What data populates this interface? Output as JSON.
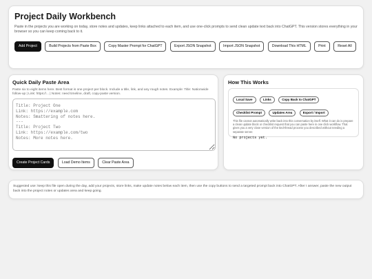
{
  "header": {
    "title": "Project Daily Workbench",
    "intro": "Paste in the projects you are working on today, store notes and updates, keep links attached to each item, and use one-click prompts to send clean update text back into ChatGPT. This version stores everything in your browser so you can keep coming back to it."
  },
  "toolbar": {
    "add_project": "Add Project",
    "build_from_paste": "Build Projects from Paste Box",
    "copy_master_prompt": "Copy Master Prompt for ChatGPT",
    "export_json": "Export JSON Snapshot",
    "import_json": "Import JSON Snapshot",
    "download_html": "Download This HTML",
    "print": "Print",
    "reset_all": "Reset All"
  },
  "paste_area": {
    "title": "Quick Daily Paste Area",
    "help": "Paste six to eight items here. Best format is one project per block. Include a title, link, and any rough notes. Example: Title: Nationwide follow-up | Link: https://... | Notes: need timeline, draft, copy-paste version.",
    "placeholder": "Title: Project One\nLink: https://example.com\nNotes: Smattering of notes here.\n---\nTitle: Project Two\nLink: https://example.com/two\nNotes: More notes here.",
    "create_cards": "Create Project Cards",
    "load_demo": "Load Demo Items",
    "clear": "Clear Paste Area"
  },
  "how": {
    "title": "How This Works",
    "chips": [
      "Local Save",
      "Links",
      "Copy Back to ChatGPT",
      "Checklist Prompt",
      "Updates Area",
      "Export / Import"
    ],
    "note": "This file cannot automatically write back into this conversation by itself. What it can do is prepare a clean update block or checklist request that you can paste here in one click workflow. That gives you a very close version of the tied-thread process you described without needing a separate server.",
    "empty_state": "No projects yet."
  },
  "footer": {
    "text": "Suggested use: keep this file open during the day, add your projects, store links, make update notes below each item, then use the copy buttons to send a targeted prompt back into ChatGPT. After I answer, paste the new output back into the project notes or updates area and keep going."
  }
}
